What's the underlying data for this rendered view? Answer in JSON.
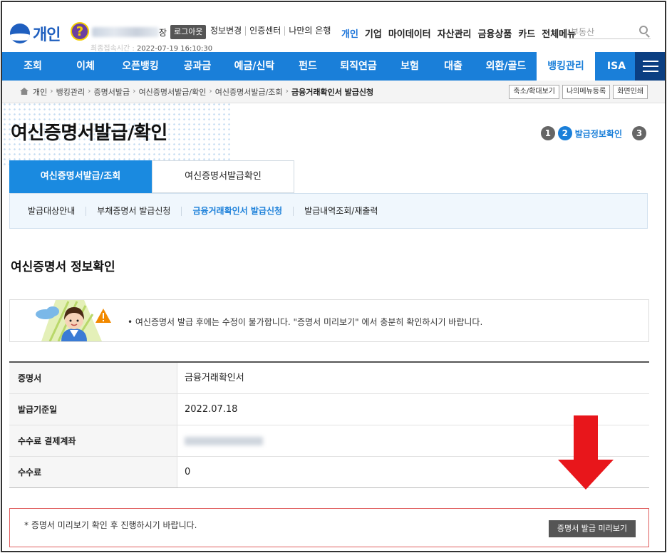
{
  "header": {
    "logo_text": "개인",
    "help_symbol": "?",
    "user_suffix": "장",
    "logout_label": "로그아웃",
    "util_links": [
      "정보변경",
      "인증센터",
      "나만의 은행"
    ],
    "login_time_label": "최종접속시간 :",
    "login_time": "2022-07-19 16:10:30",
    "biz_links": [
      {
        "label": "개인",
        "active": true
      },
      {
        "label": "기업",
        "active": false
      },
      {
        "label": "마이데이터",
        "active": false
      },
      {
        "label": "자산관리",
        "active": false
      },
      {
        "label": "금융상품",
        "active": false
      },
      {
        "label": "카드",
        "active": false
      },
      {
        "label": "전체메뉴",
        "active": false
      }
    ],
    "search_placeholder": "부동산"
  },
  "nav": {
    "items": [
      {
        "label": "조회",
        "width": 86,
        "active": false
      },
      {
        "label": "이체",
        "width": 62,
        "active": false
      },
      {
        "label": "오픈뱅킹",
        "width": 92,
        "active": false
      },
      {
        "label": "공과금",
        "width": 68,
        "active": false
      },
      {
        "label": "예금/신탁",
        "width": 92,
        "active": false
      },
      {
        "label": "펀드",
        "width": 58,
        "active": false
      },
      {
        "label": "퇴직연금",
        "width": 84,
        "active": false
      },
      {
        "label": "보험",
        "width": 60,
        "active": false
      },
      {
        "label": "대출",
        "width": 62,
        "active": false
      },
      {
        "label": "외환/골드",
        "width": 86,
        "active": false
      },
      {
        "label": "뱅킹관리",
        "width": 82,
        "active": true
      },
      {
        "label": "ISA",
        "width": 60,
        "active": false
      }
    ]
  },
  "breadcrumb": {
    "items": [
      "개인",
      "뱅킹관리",
      "증명서발급",
      "여신증명서발급/확인",
      "여신증명서발급/조회",
      "금융거래확인서 발급신청"
    ],
    "tools": [
      "축소/확대보기",
      "나의메뉴등록",
      "화면인쇄"
    ]
  },
  "page": {
    "title": "여신증명서발급/확인",
    "steps": {
      "step1": "1",
      "step2": "2",
      "step2_label": "발급정보확인",
      "step3": "3"
    }
  },
  "tabs": [
    {
      "label": "여신증명서발급/조회",
      "active": true
    },
    {
      "label": "여신증명서발급확인",
      "active": false
    }
  ],
  "subtabs": [
    {
      "label": "발급대상안내",
      "active": false
    },
    {
      "label": "부채증명서 발급신청",
      "active": false
    },
    {
      "label": "금융거래확인서 발급신청",
      "active": true
    },
    {
      "label": "발급내역조회/재출력",
      "active": false
    }
  ],
  "section": {
    "title": "여신증명서 정보확인",
    "notice": "• 여신증명서 발급 후에는 수정이 불가합니다. \"증명서 미리보기\" 에서 충분히 확인하시기 바랍니다."
  },
  "info_rows": [
    {
      "label": "증명서",
      "value": "금융거래확인서"
    },
    {
      "label": "발급기준일",
      "value": "2022.07.18"
    },
    {
      "label": "수수료 결제계좌",
      "value": "",
      "masked": true
    },
    {
      "label": "수수료",
      "value": "0"
    }
  ],
  "bottom": {
    "note": "* 증명서 미리보기 확인 후 진행하시기 바랍니다.",
    "preview_button": "증명서 발급 미리보기"
  },
  "colors": {
    "primary": "#1a7fd9",
    "nav_active_text": "#1a7fd9",
    "arrow": "#e8161b",
    "box_border": "#e06060"
  }
}
